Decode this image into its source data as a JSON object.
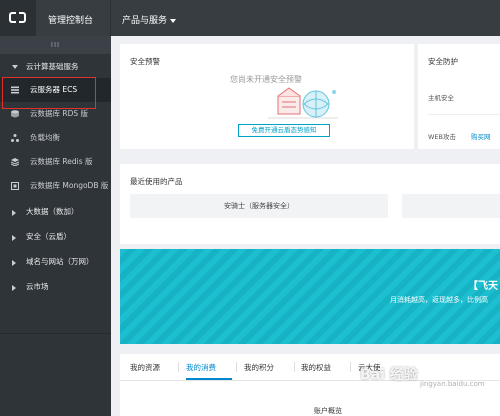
{
  "topbar": {
    "console_title": "管理控制台",
    "products_menu": "产品与服务"
  },
  "sidebar": {
    "collapse_glyph": "III",
    "section_compute": "云计算基础服务",
    "items": [
      {
        "label": "云服务器 ECS",
        "icon": "server-icon"
      },
      {
        "label": "云数据库 RDS 版",
        "icon": "database-icon"
      },
      {
        "label": "负载均衡",
        "icon": "load-balancer-icon"
      },
      {
        "label": "云数据库 Redis 版",
        "icon": "redis-icon"
      },
      {
        "label": "云数据库 MongoDB 版",
        "icon": "mongodb-icon"
      }
    ],
    "sections": [
      {
        "label": "大数据（数加）"
      },
      {
        "label": "安全（云盾）"
      },
      {
        "label": "域名与网站（万网）"
      },
      {
        "label": "云市场"
      }
    ]
  },
  "alert_card": {
    "title": "安全预警",
    "message": "您尚未开通安全预警",
    "button": "免费开通云盾态势感知"
  },
  "protect_card": {
    "title": "安全防护",
    "host_security": "主机安全",
    "web_attack": "WEB攻击",
    "buy_link": "购买网"
  },
  "recent_card": {
    "title": "最近使用的产品",
    "tiles": [
      "安骑士（服务器安全）"
    ]
  },
  "banner": {
    "title": "【飞天",
    "subtitle": "月消耗越高，返现越多，比例高"
  },
  "tabs": {
    "items": [
      "我的资源",
      "我的消费",
      "我的积分",
      "我的权益",
      "云大使"
    ],
    "active_index": 1,
    "account_overview": "账户概览"
  },
  "watermark": {
    "text": "Bai 经验",
    "sub": "jingyan.baidu.com"
  },
  "colors": {
    "topbar": "#373d41",
    "sidebar": "#2f3439",
    "accent": "#00a2ca",
    "link": "#0088cc",
    "banner": "#1cbfcf",
    "highlight": "#e0312b"
  }
}
